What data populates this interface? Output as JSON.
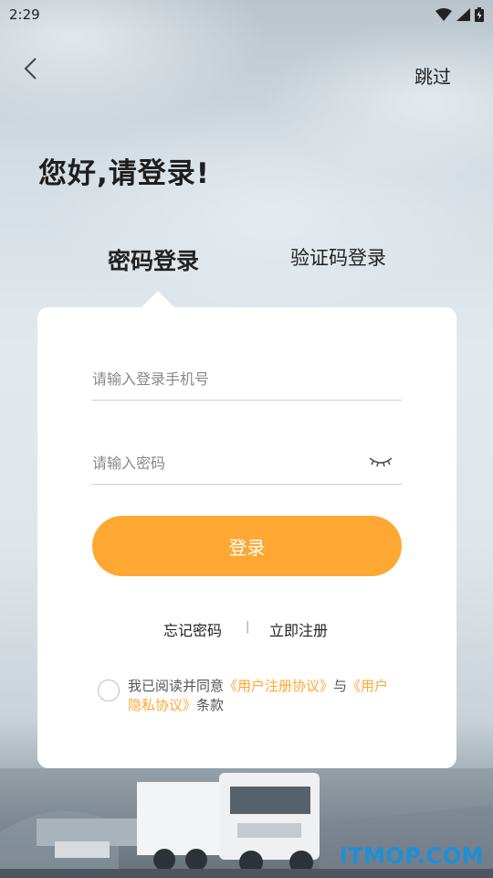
{
  "status_bar": {
    "time": "2:29",
    "icons": [
      "wifi-icon",
      "signal-icon",
      "battery-icon"
    ]
  },
  "nav": {
    "back_icon": "chevron-left-icon",
    "skip_label": "跳过"
  },
  "greeting": "您好,请登录!",
  "tabs": [
    {
      "label": "密码登录",
      "active": true
    },
    {
      "label": "验证码登录",
      "active": false
    }
  ],
  "form": {
    "phone_placeholder": "请输入登录手机号",
    "phone_value": "",
    "password_placeholder": "请输入密码",
    "password_value": "",
    "eye_icon": "eye-closed-icon",
    "login_label": "登录"
  },
  "links": {
    "forgot": "忘记密码",
    "separator": "|",
    "register": "立即注册"
  },
  "agreement": {
    "checked": false,
    "prefix": "我已阅读并同意",
    "user_agreement": "《用户注册协议》",
    "connector": "与",
    "privacy_agreement": "《用户隐私协议》",
    "suffix": "条款"
  },
  "watermark": "ITMOP.COM",
  "colors": {
    "accent": "#ffa733",
    "watermark": "#1e8fd8"
  }
}
